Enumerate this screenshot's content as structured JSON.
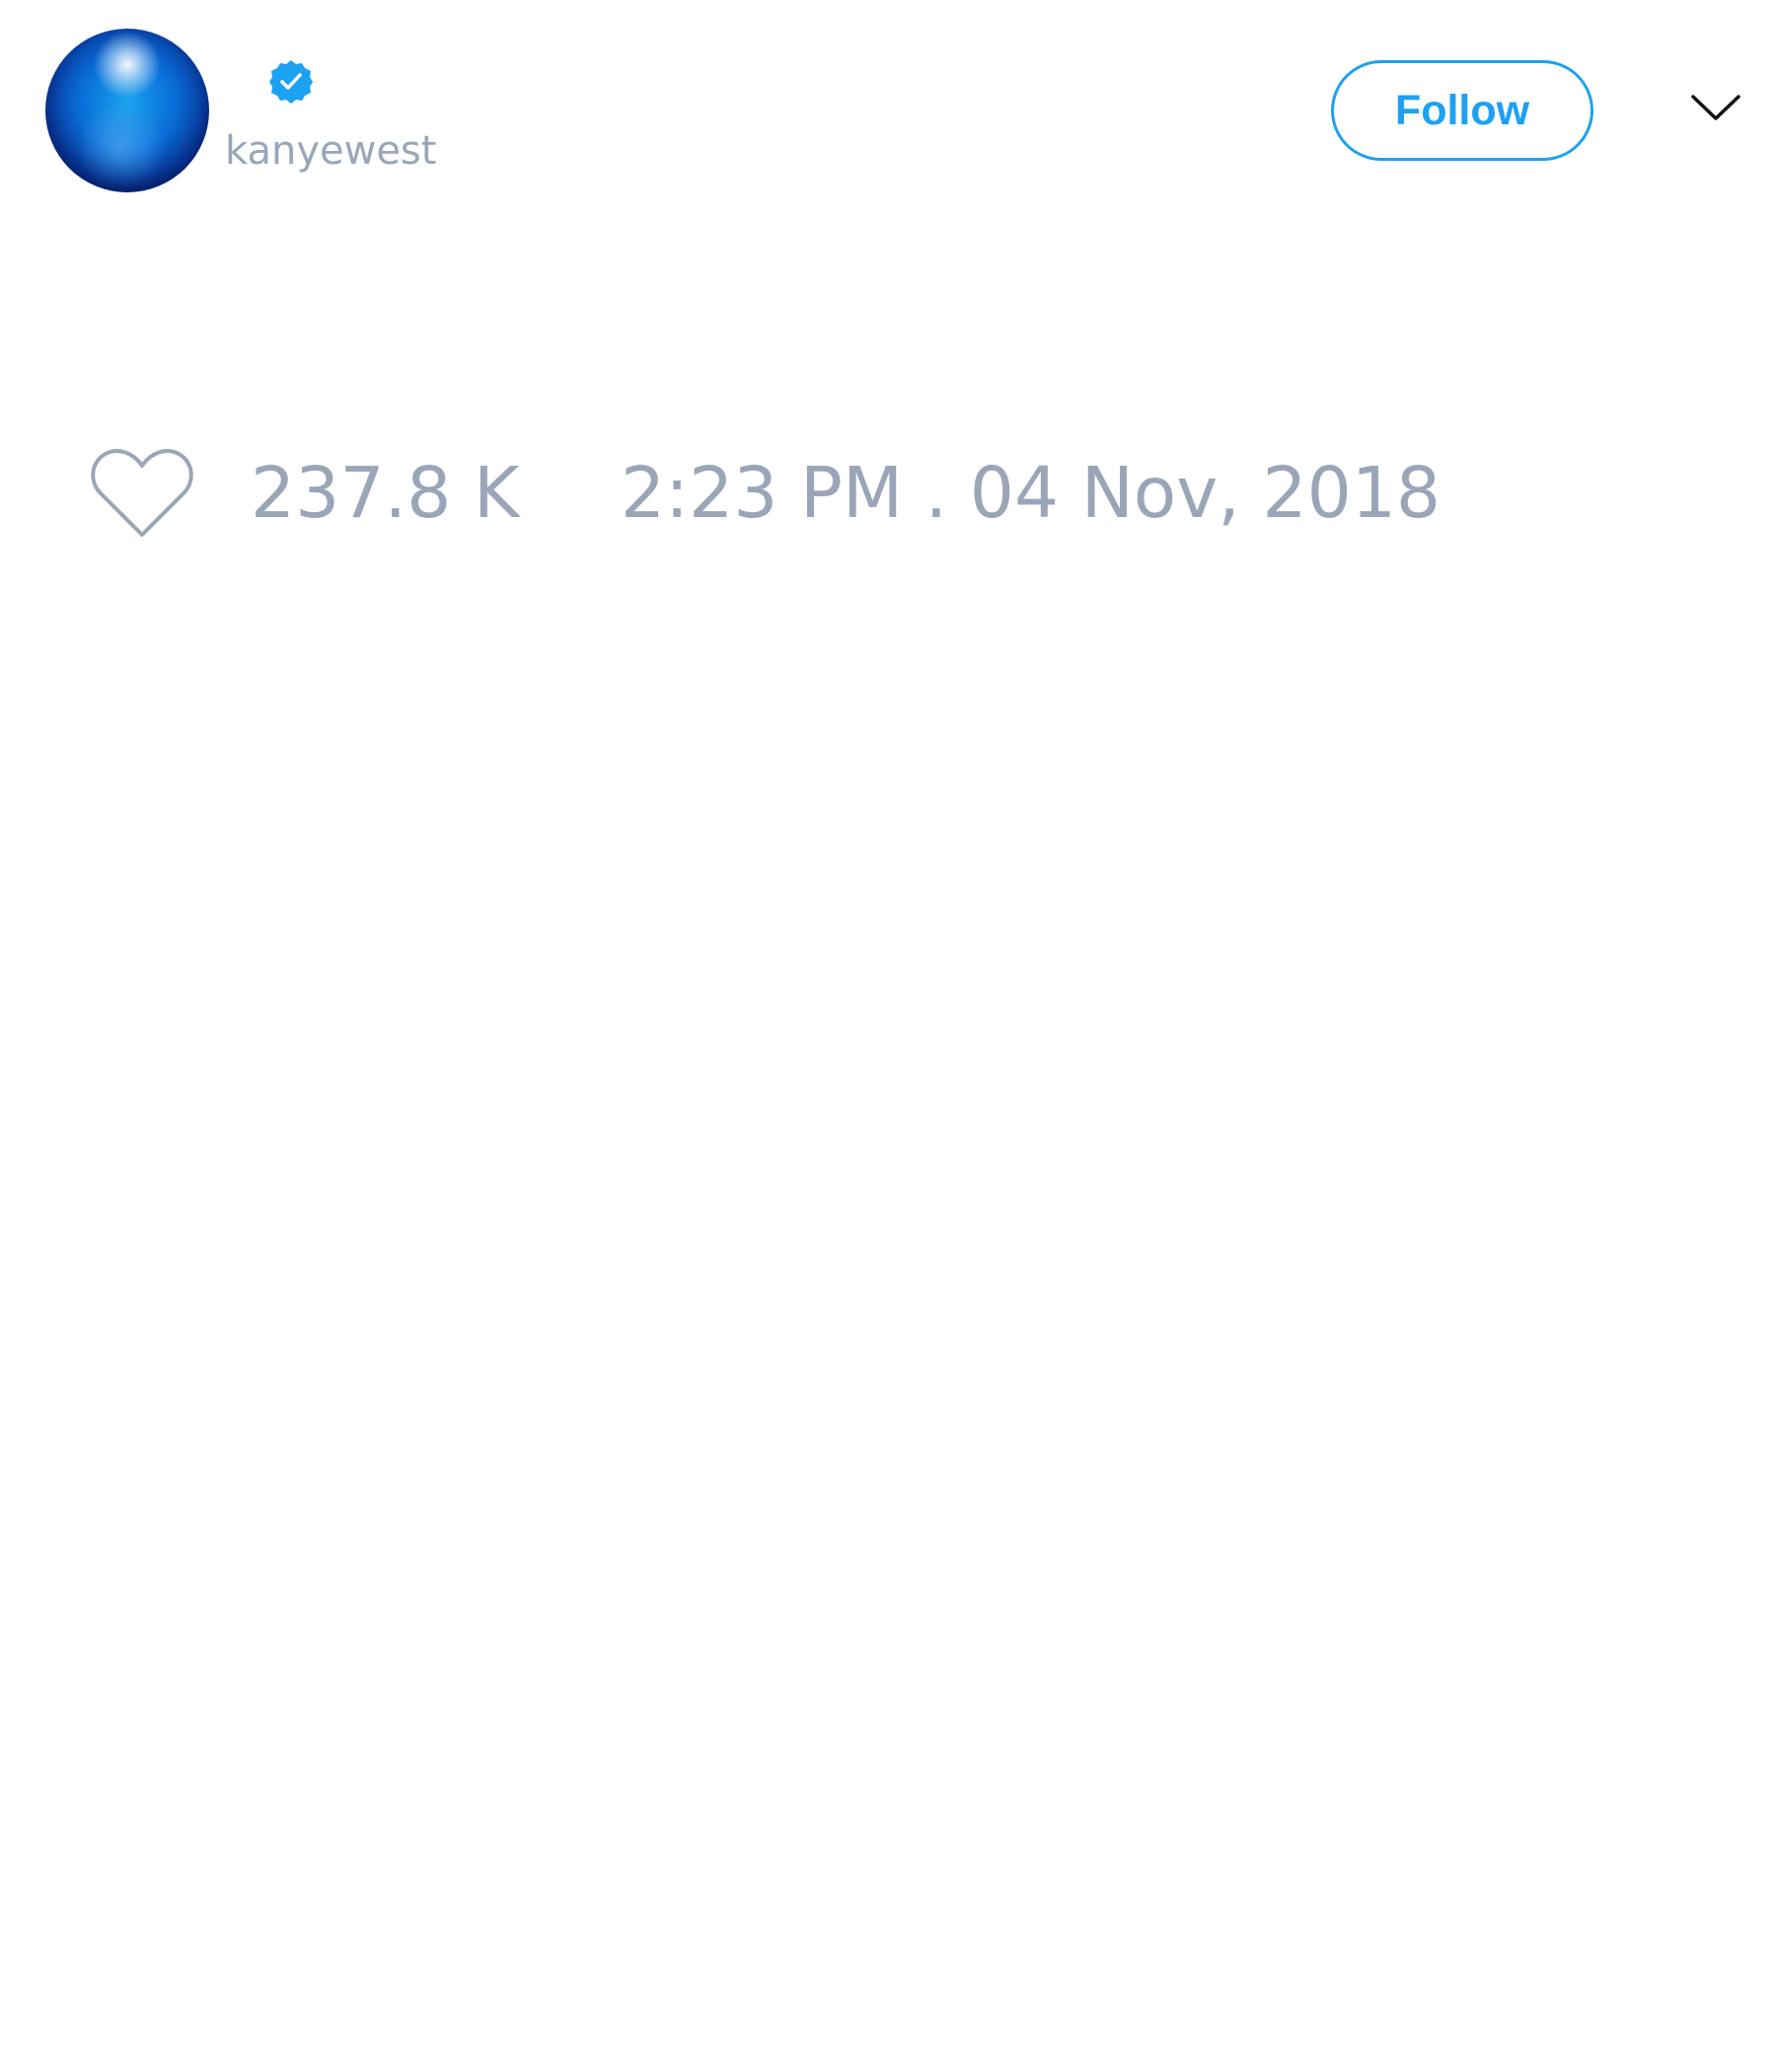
{
  "tweet": {
    "handle": "kanyewest",
    "follow_label": "Follow",
    "like_count": "237.8 K",
    "timestamp": "2:23 PM . 04 Nov, 2018"
  },
  "icons": {
    "verified": "verified-badge-icon",
    "menu": "chevron-down-icon",
    "like": "heart-icon"
  },
  "colors": {
    "accent": "#1da1f2",
    "muted_text": "#9aa6b8",
    "icon_stroke": "#9aa6b8",
    "chevron": "#111111"
  }
}
